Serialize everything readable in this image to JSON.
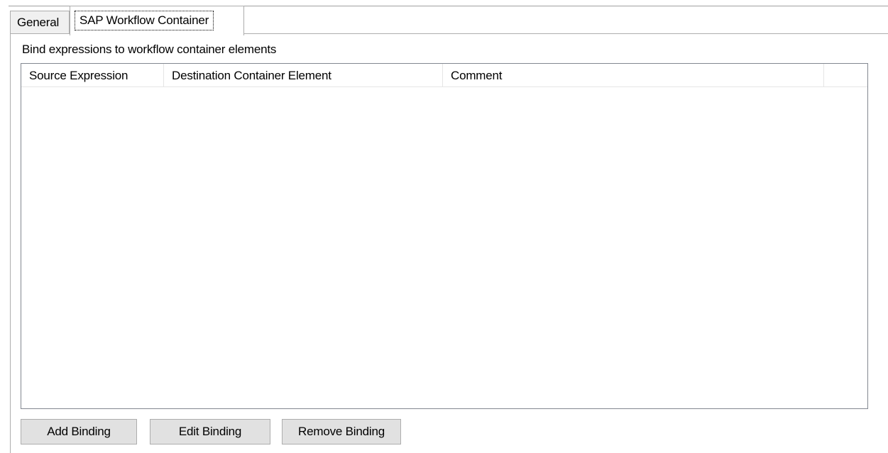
{
  "tabs": {
    "general_label": "General",
    "sap_label": "SAP Workflow Container"
  },
  "panel": {
    "caption": "Bind expressions to workflow container elements"
  },
  "bindings_table": {
    "columns": [
      "Source Expression",
      "Destination Container Element",
      "Comment",
      ""
    ],
    "rows": []
  },
  "buttons": {
    "add_label": "Add Binding",
    "edit_label": "Edit Binding",
    "remove_label": "Remove Binding"
  },
  "colors": {
    "border": "#adadad",
    "button_face": "#e1e1e1",
    "tab_inactive": "#f0f0f0",
    "grid_line": "#e5e5e5"
  }
}
